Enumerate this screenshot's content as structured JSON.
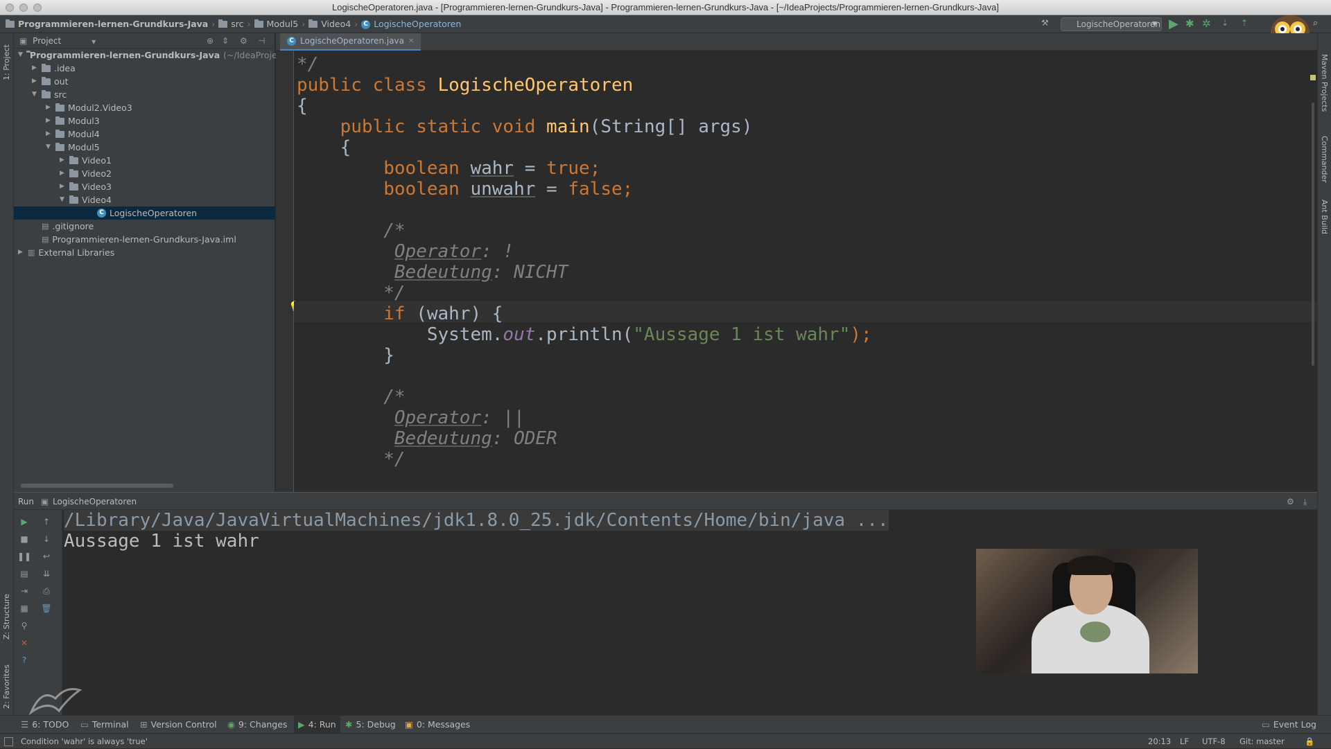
{
  "window": {
    "title": "LogischeOperatoren.java - [Programmieren-lernen-Grundkurs-Java] - Programmieren-lernen-Grundkurs-Java - [~/IdeaProjects/Programmieren-lernen-Grundkurs-Java]"
  },
  "breadcrumbs": [
    "Programmieren-lernen-Grundkurs-Java",
    "src",
    "Modul5",
    "Video4",
    "LogischeOperatoren"
  ],
  "run_config": {
    "selected": "LogischeOperatoren"
  },
  "left_strip": {
    "project_label": "1: Project",
    "structure_label": "Z: Structure",
    "favorites_label": "2: Favorites"
  },
  "right_strip": {
    "maven_label": "Maven Projects",
    "commander_label": "Commander",
    "ant_label": "Ant Build"
  },
  "project_panel": {
    "header": "Project",
    "tree": [
      {
        "label": "Programmieren-lernen-Grundkurs-Java",
        "suffix": "(~/IdeaProjec",
        "depth": 0,
        "expanded": true,
        "type": "module"
      },
      {
        "label": ".idea",
        "depth": 1,
        "expanded": false,
        "type": "folder"
      },
      {
        "label": "out",
        "depth": 1,
        "expanded": false,
        "type": "folder"
      },
      {
        "label": "src",
        "depth": 1,
        "expanded": true,
        "type": "folder"
      },
      {
        "label": "Modul2.Video3",
        "depth": 2,
        "expanded": false,
        "type": "folder"
      },
      {
        "label": "Modul3",
        "depth": 2,
        "expanded": false,
        "type": "folder"
      },
      {
        "label": "Modul4",
        "depth": 2,
        "expanded": false,
        "type": "folder"
      },
      {
        "label": "Modul5",
        "depth": 2,
        "expanded": true,
        "type": "folder"
      },
      {
        "label": "Video1",
        "depth": 3,
        "expanded": false,
        "type": "folder"
      },
      {
        "label": "Video2",
        "depth": 3,
        "expanded": false,
        "type": "folder"
      },
      {
        "label": "Video3",
        "depth": 3,
        "expanded": false,
        "type": "folder"
      },
      {
        "label": "Video4",
        "depth": 3,
        "expanded": true,
        "type": "folder"
      },
      {
        "label": "LogischeOperatoren",
        "depth": 5,
        "type": "class",
        "selected": true
      },
      {
        "label": ".gitignore",
        "depth": 1,
        "type": "file"
      },
      {
        "label": "Programmieren-lernen-Grundkurs-Java.iml",
        "depth": 1,
        "type": "file"
      },
      {
        "label": "External Libraries",
        "depth": 0,
        "expanded": false,
        "type": "library"
      }
    ]
  },
  "editor": {
    "tab_label": "LogischeOperatoren.java",
    "code": {
      "l1": "*/",
      "l2_kw": "public class ",
      "l2_name": "LogischeOperatoren",
      "l3": "{",
      "l4_kw": "public static void ",
      "l4_name": "main",
      "l4_rest": "(String[] args)",
      "l5": "{",
      "l6_kw": "boolean ",
      "l6_var": "wahr",
      "l6_eq": " = ",
      "l6_val": "true",
      "l6_end": ";",
      "l7_kw": "boolean ",
      "l7_var": "unwahr",
      "l7_eq": " = ",
      "l7_val": "false",
      "l7_end": ";",
      "l9": "/*",
      "l10_a": "Operator",
      "l10_b": ": !",
      "l11_a": "Bedeutung",
      "l11_b": ": NICHT",
      "l12": "*/",
      "l13_kw": "if ",
      "l13_rest": "(wahr) {",
      "l14_a": "System.",
      "l14_out": "out",
      "l14_b": ".println(",
      "l14_str": "\"Aussage 1 ist wahr\"",
      "l14_end": ");",
      "l15": "}",
      "l17": "/*",
      "l18_a": "Operator",
      "l18_b": ": ||",
      "l19_a": "Bedeutung",
      "l19_b": ": ODER",
      "l20": "*/"
    }
  },
  "run_panel": {
    "label": "Run",
    "config": "LogischeOperatoren",
    "console": {
      "line1": "/Library/Java/JavaVirtualMachines/jdk1.8.0_25.jdk/Contents/Home/bin/java ...",
      "line2": "Aussage 1 ist wahr"
    }
  },
  "bottom_tabs": [
    {
      "label": "6: TODO",
      "icon": "todo-icon"
    },
    {
      "label": "Terminal",
      "icon": "terminal-icon"
    },
    {
      "label": "Version Control",
      "icon": "vcs-icon"
    },
    {
      "label": "9: Changes",
      "icon": "changes-icon"
    },
    {
      "label": "4: Run",
      "icon": "run-icon"
    },
    {
      "label": "5: Debug",
      "icon": "debug-icon"
    },
    {
      "label": "0: Messages",
      "icon": "messages-icon"
    }
  ],
  "event_log": "Event Log",
  "status": {
    "message": "Condition 'wahr' is always 'true'",
    "position": "20:13",
    "line_sep": "LF",
    "encoding": "UTF-8",
    "git": "Git: master"
  },
  "colors": {
    "keyword": "#cc7832",
    "method": "#ffc66d",
    "comment": "#808080",
    "string": "#6a8759",
    "selection": "#0d293e"
  }
}
